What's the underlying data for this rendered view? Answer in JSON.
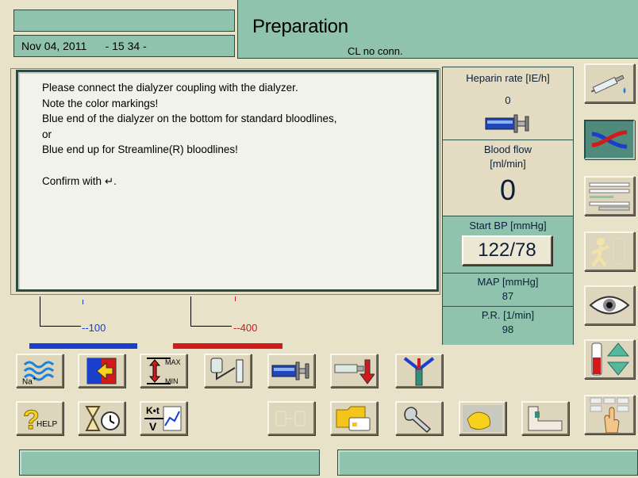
{
  "header": {
    "title": "Preparation",
    "connection_status": "CL no conn.",
    "date": "Nov 04, 2011",
    "time": "- 15 34 -"
  },
  "message": {
    "lines": [
      "Please connect the dialyzer coupling with the dialyzer.",
      "Note the color markings!",
      "Blue end of the dialyzer on the bottom for standard bloodlines,",
      "or",
      "Blue end up for Streamline(R) bloodlines!",
      "Confirm with ↵."
    ]
  },
  "pressures": {
    "venous": "-100",
    "arterial": "-400"
  },
  "info_panel": {
    "heparin_label": "Heparin rate  [IE/h]",
    "heparin_value": "0",
    "blood_flow_label_1": "Blood flow",
    "blood_flow_label_2": "[ml/min]",
    "blood_flow_value": "0",
    "start_bp_label": "Start BP [mmHg]",
    "start_bp_value": "122/78",
    "map_label": "MAP   [mmHg]",
    "map_value": "87",
    "pr_label": "P.R. [1/min]",
    "pr_value": "98"
  },
  "buttons": {
    "sodium_label": "Na",
    "sodium_sup": "+",
    "max_label": "MAX",
    "min_label": "MIN",
    "help_label": "HELP",
    "kt_top": "K•t",
    "kt_bottom": "V"
  },
  "colors": {
    "header_green": "#8fc3ad",
    "venous_blue": "#1a3fcc",
    "arterial_red": "#d21a1a",
    "panel_border": "#2c4a42"
  }
}
